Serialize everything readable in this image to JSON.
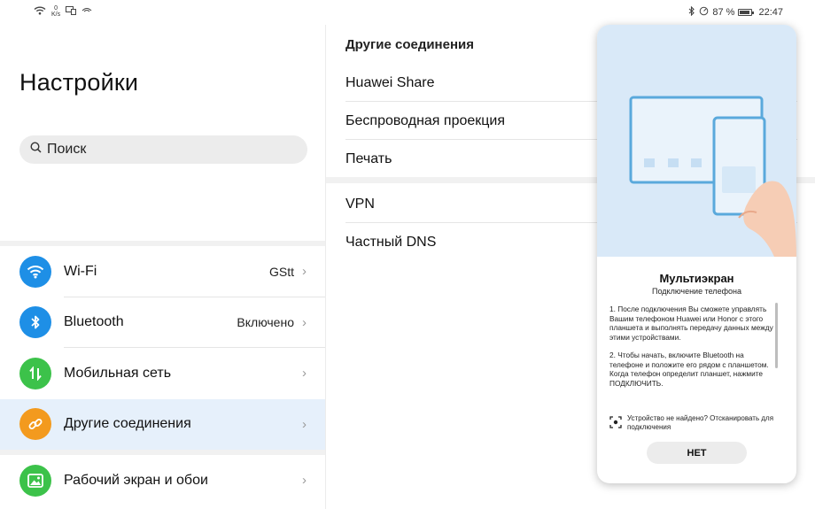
{
  "status_bar": {
    "net_speed_value": "0",
    "net_speed_unit": "K/s",
    "battery": "87 %",
    "battery_level": 0.87,
    "time": "22:47"
  },
  "left_pane": {
    "title": "Настройки",
    "search": {
      "placeholder": "Поиск"
    },
    "items": [
      {
        "label": "Wi-Fi",
        "value": "GStt",
        "icon": "wifi-icon",
        "color": "#1e8fe6"
      },
      {
        "label": "Bluetooth",
        "value": "Включено",
        "icon": "bluetooth-icon",
        "color": "#1e8fe6"
      },
      {
        "label": "Мобильная сеть",
        "value": "",
        "icon": "mobile-network-icon",
        "color": "#3cc24a"
      },
      {
        "label": "Другие соединения",
        "value": "",
        "icon": "link-icon",
        "color": "#f39a1e"
      },
      {
        "label": "Рабочий экран и обои",
        "value": "",
        "icon": "wallpaper-icon",
        "color": "#3cc24a"
      }
    ]
  },
  "right_pane": {
    "section_title": "Другие соединения",
    "items": [
      {
        "label": "Huawei Share"
      },
      {
        "label": "Беспроводная проекция"
      },
      {
        "label": "Печать"
      },
      {
        "label": "VPN"
      },
      {
        "label": "Частный DNS"
      }
    ]
  },
  "dialog": {
    "title": "Мультиэкран",
    "subtitle": "Подключение телефона",
    "paragraph1": "1. После подключения Вы сможете управлять Вашим телефоном Huawei или Honor с этого планшета и выполнять передачу данных между этими устройствами.",
    "paragraph2": "2. Чтобы начать, включите Bluetooth на телефоне и положите его рядом с планшетом. Когда телефон определит планшет, нажмите ПОДКЛЮЧИТЬ.",
    "note": "Устройство не найдено? Отсканировать для подключения",
    "button": "НЕТ"
  }
}
